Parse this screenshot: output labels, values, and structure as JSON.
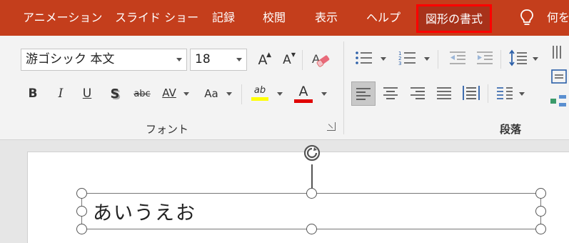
{
  "tabs": [
    {
      "label": "アニメーション"
    },
    {
      "label": "スライド ショー"
    },
    {
      "label": "記録"
    },
    {
      "label": "校閲"
    },
    {
      "label": "表示"
    },
    {
      "label": "ヘルプ"
    },
    {
      "label": "図形の書式",
      "highlighted": true
    }
  ],
  "tell_me": {
    "label": "何を"
  },
  "font": {
    "name": "游ゴシック 本文",
    "size": "18",
    "group_label": "フォント",
    "grow_label": "A",
    "shrink_label": "A",
    "bold_label": "B",
    "italic_label": "I",
    "underline_label": "U",
    "shadow_label": "S",
    "strike_label": "abc",
    "spacing_label": "AV",
    "case_label": "Aa",
    "highlight_label": "ab",
    "color_label": "A",
    "highlight_color": "#ffff00",
    "font_color": "#e00000"
  },
  "paragraph": {
    "group_label": "段落"
  },
  "textbox": {
    "text": "あいうえお"
  },
  "colors": {
    "tab_bar": "#c43e1c",
    "highlight_border": "#ff0000",
    "ribbon": "#f3f3f3"
  }
}
